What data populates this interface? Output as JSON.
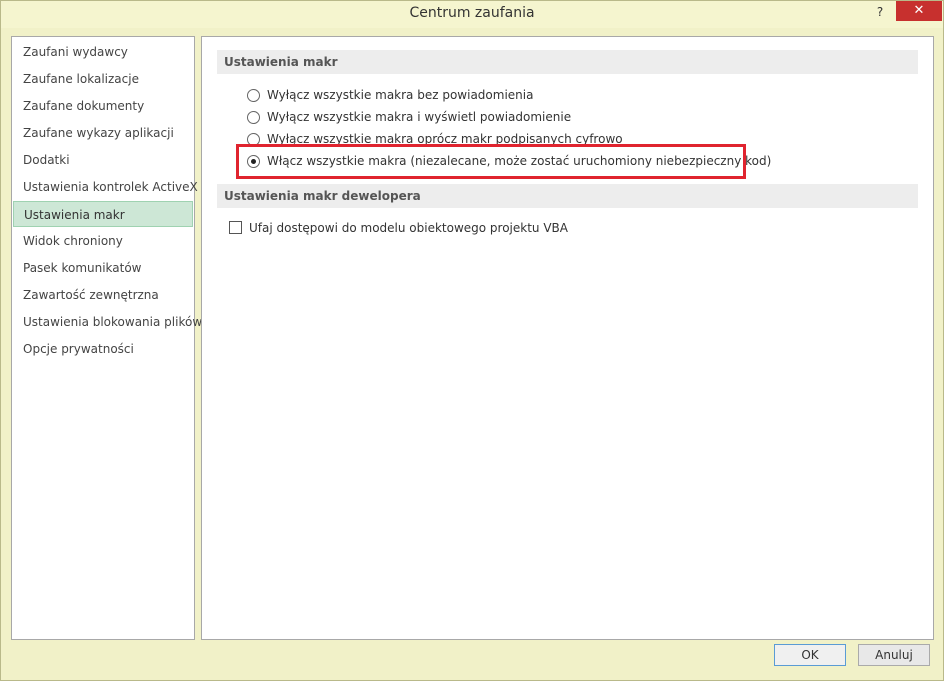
{
  "window": {
    "title": "Centrum zaufania",
    "help_label": "?",
    "close_label": "✕"
  },
  "sidebar": {
    "items": [
      {
        "label": "Zaufani wydawcy"
      },
      {
        "label": "Zaufane lokalizacje"
      },
      {
        "label": "Zaufane dokumenty"
      },
      {
        "label": "Zaufane wykazy aplikacji"
      },
      {
        "label": "Dodatki"
      },
      {
        "label": "Ustawienia kontrolek ActiveX"
      },
      {
        "label": "Ustawienia makr",
        "selected": true
      },
      {
        "label": "Widok chroniony"
      },
      {
        "label": "Pasek komunikatów"
      },
      {
        "label": "Zawartość zewnętrzna"
      },
      {
        "label": "Ustawienia blokowania plików"
      },
      {
        "label": "Opcje prywatności"
      }
    ]
  },
  "macro_settings": {
    "header": "Ustawienia makr",
    "options": [
      {
        "label": "Wyłącz wszystkie makra bez powiadomienia",
        "checked": false
      },
      {
        "label": "Wyłącz wszystkie makra i wyświetl powiadomienie",
        "checked": false
      },
      {
        "label": "Wyłącz wszystkie makra oprócz makr podpisanych cyfrowo",
        "checked": false
      },
      {
        "label": "Włącz wszystkie makra (niezalecane, może zostać uruchomiony niebezpieczny kod)",
        "checked": true
      }
    ]
  },
  "developer_settings": {
    "header": "Ustawienia makr dewelopera",
    "trust_vba_label": "Ufaj dostępowi do modelu obiektowego projektu VBA",
    "trust_vba_checked": false
  },
  "buttons": {
    "ok": "OK",
    "cancel": "Anuluj"
  },
  "colors": {
    "selected_nav_bg": "#cde7d6",
    "highlight_border": "#e0242f",
    "close_button_bg": "#c7302e"
  }
}
